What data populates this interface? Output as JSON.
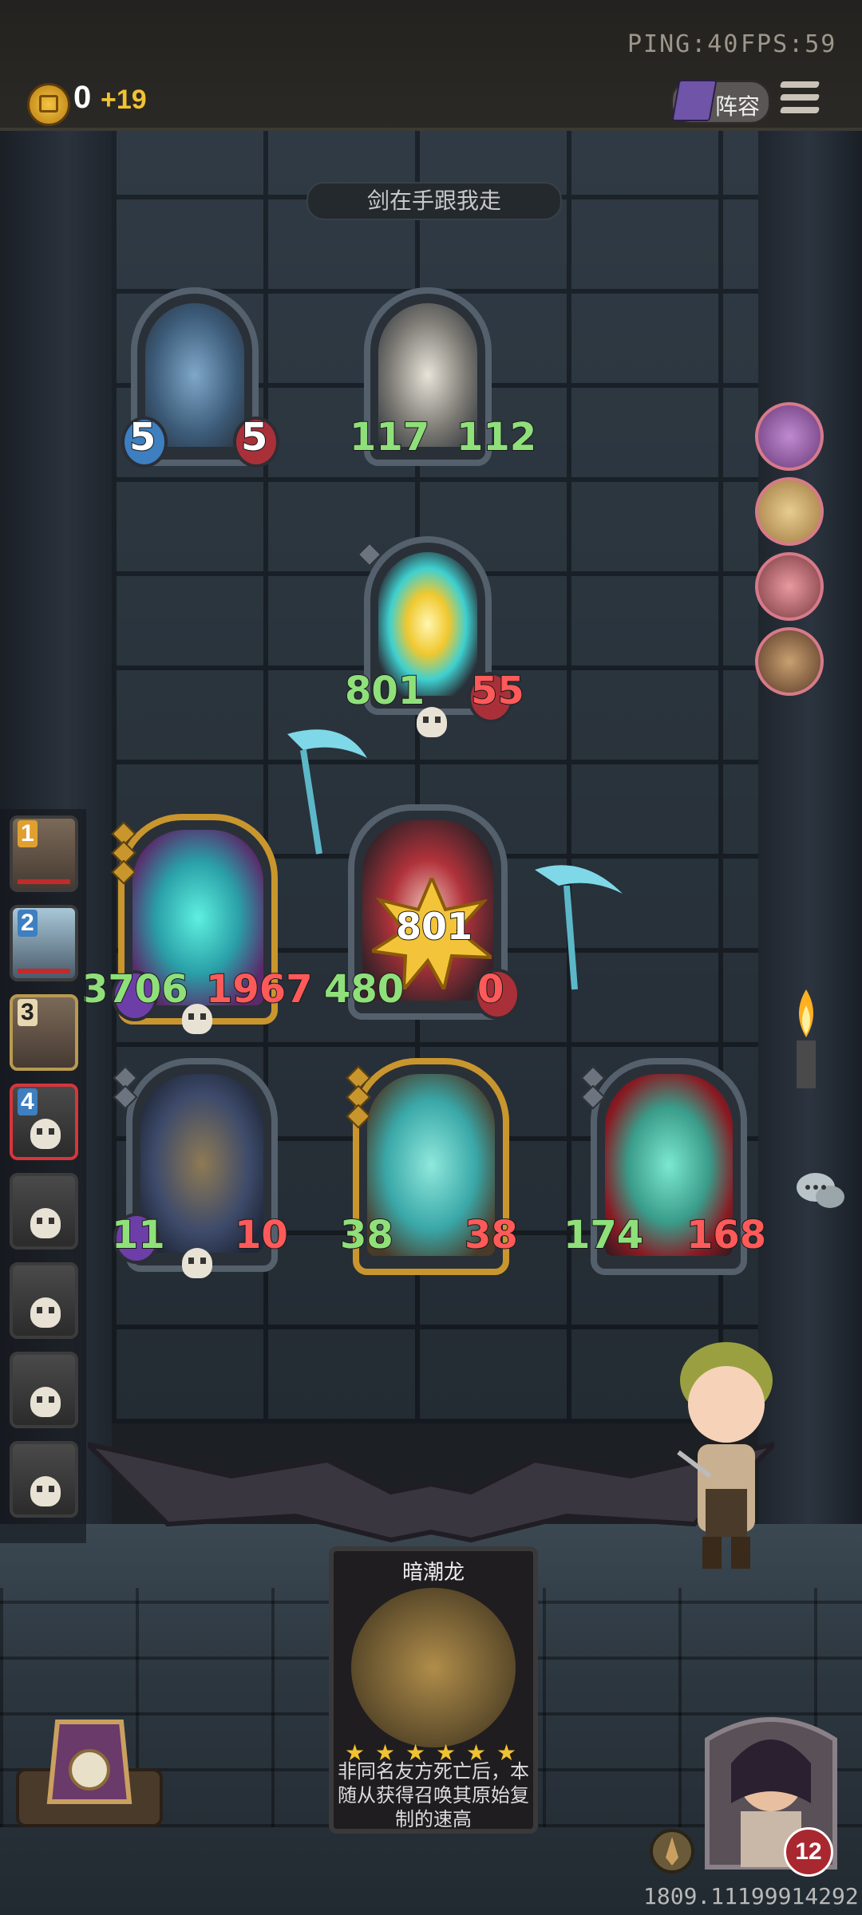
{
  "status": {
    "ping": "PING:40",
    "fps": "FPS:59"
  },
  "resources": {
    "gold": "0",
    "gold_income": "+19"
  },
  "header": {
    "lineup_label": "阵容"
  },
  "battle_banner": "剑在手跟我走",
  "enemy_row1": [
    {
      "name": "robot",
      "attack": "5",
      "health": "5"
    },
    {
      "name": "ballerina-robot",
      "attack": "117",
      "health": "112"
    }
  ],
  "enemy_row2": [
    {
      "name": "electric-golem",
      "attack": "801",
      "health": "55"
    }
  ],
  "player_row1": [
    {
      "name": "ghost-wolf",
      "attack": "3706",
      "health": "1967"
    },
    {
      "name": "red-hat-girl",
      "attack": "480",
      "health": "0",
      "damage_popup": "801"
    }
  ],
  "player_row2": [
    {
      "name": "dark-tide-dragon",
      "attack": "11",
      "health": "10"
    },
    {
      "name": "ghost-warrior",
      "attack": "38",
      "health": "38"
    },
    {
      "name": "ghost-brute",
      "attack": "174",
      "health": "168"
    }
  ],
  "sidebar": {
    "slots": [
      "1",
      "2",
      "3",
      "4",
      "",
      "",
      "",
      ""
    ]
  },
  "detail_card": {
    "title": "暗潮龙",
    "stars": 6,
    "description": "非同名友方死亡后，本随从获得召唤其原始复制的速高"
  },
  "player": {
    "health": "12"
  },
  "coords": "1809.11199914292",
  "colors": {
    "attack": "#8fe07a",
    "health": "#ff5a5a",
    "gold": "#f1c232",
    "frame_gold": "#c9962e"
  }
}
